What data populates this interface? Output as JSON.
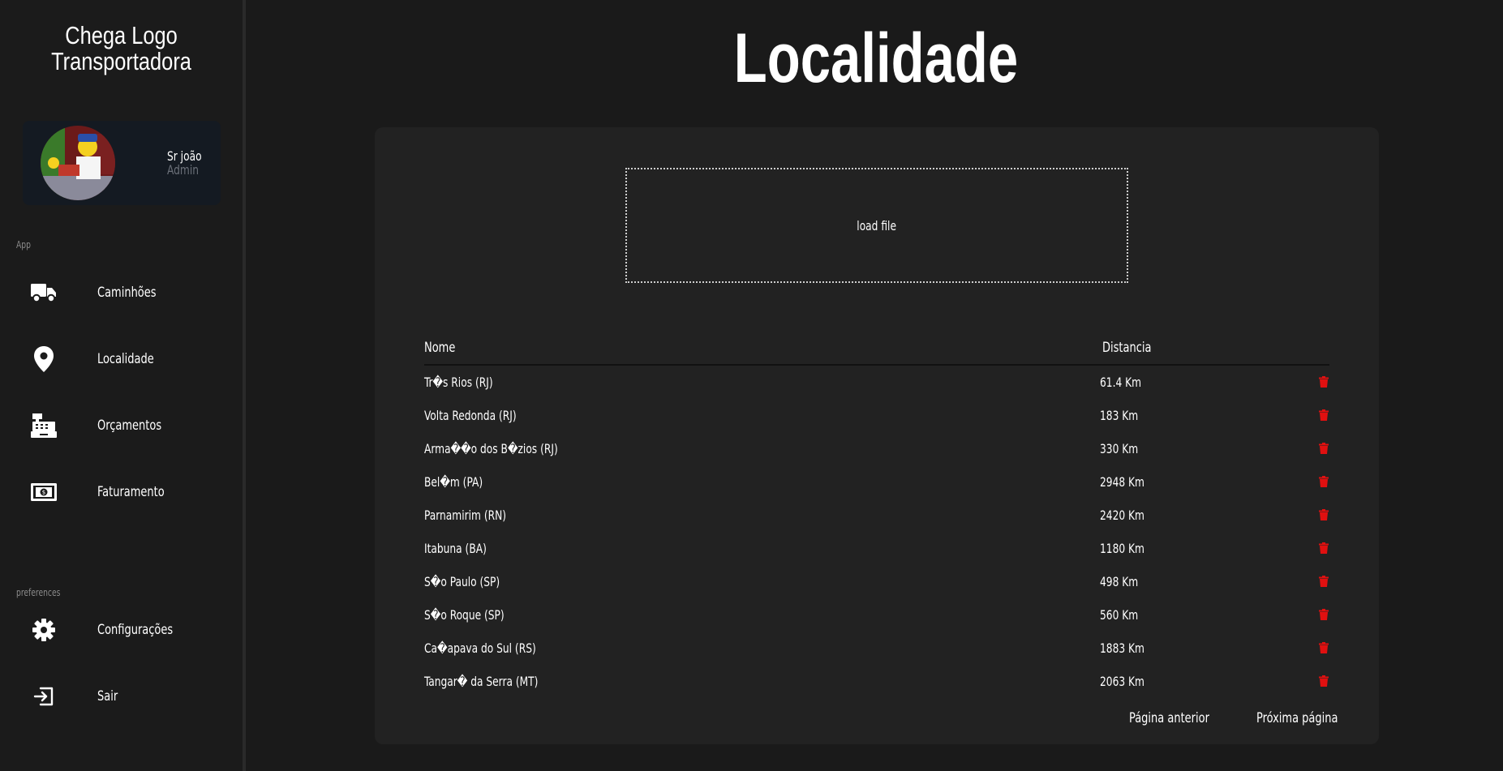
{
  "sidebar": {
    "brand_line1": "Chega Logo",
    "brand_line2": "Transportadora",
    "user": {
      "name": "Sr joão",
      "role": "Admin"
    },
    "section_app": "App",
    "section_preferences": "preferences",
    "app_items": [
      {
        "label": "Caminhões",
        "icon": "truck-icon"
      },
      {
        "label": "Localidade",
        "icon": "map-pin-icon"
      },
      {
        "label": "Orçamentos",
        "icon": "cash-register-icon"
      },
      {
        "label": "Faturamento",
        "icon": "money-bill-icon"
      }
    ],
    "pref_items": [
      {
        "label": "Configurações",
        "icon": "gear-icon"
      },
      {
        "label": "Sair",
        "icon": "logout-icon"
      }
    ]
  },
  "main": {
    "title": "Localidade",
    "dropzone_label": "load file",
    "table": {
      "headers": {
        "name": "Nome",
        "distance": "Distancia"
      },
      "rows": [
        {
          "name": "Tr�s Rios (RJ)",
          "distance": "61.4 Km"
        },
        {
          "name": "Volta Redonda (RJ)",
          "distance": "183 Km"
        },
        {
          "name": "Arma��o dos B�zios (RJ)",
          "distance": "330 Km"
        },
        {
          "name": "Bel�m (PA)",
          "distance": "2948 Km"
        },
        {
          "name": "Parnamirim (RN)",
          "distance": "2420 Km"
        },
        {
          "name": "Itabuna (BA)",
          "distance": "1180 Km"
        },
        {
          "name": "S�o Paulo (SP)",
          "distance": "498 Km"
        },
        {
          "name": "S�o Roque (SP)",
          "distance": "560 Km"
        },
        {
          "name": "Ca�apava do Sul (RS)",
          "distance": "1883 Km"
        },
        {
          "name": "Tangar� da Serra (MT)",
          "distance": "2063 Km"
        }
      ]
    },
    "pagination": {
      "prev": "Página anterior",
      "next": "Próxima página"
    }
  },
  "colors": {
    "background": "#1a1a1a",
    "card": "#222222",
    "delete": "#e01010",
    "profile_bg": "#141a22"
  }
}
